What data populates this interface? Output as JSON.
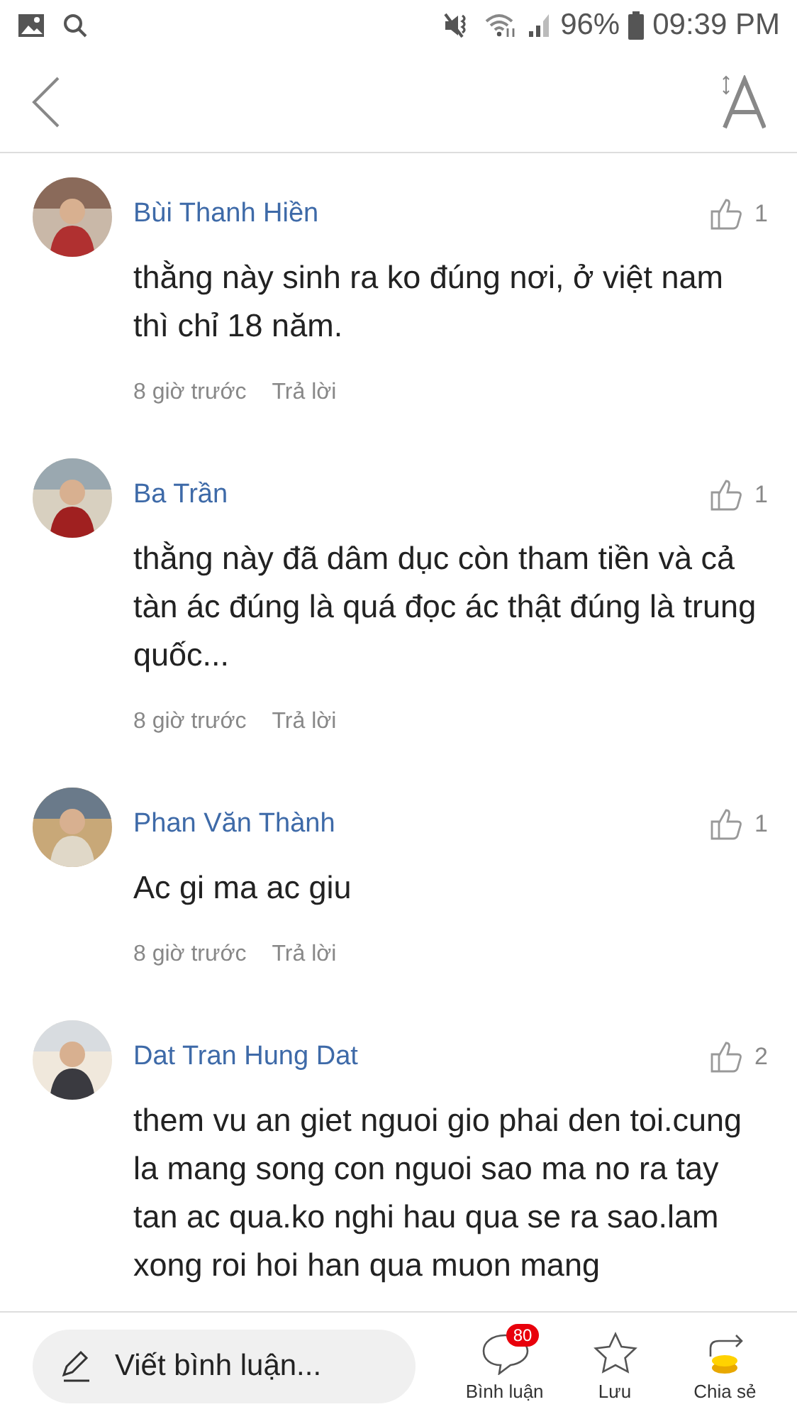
{
  "status_bar": {
    "battery": "96%",
    "time": "09:39 PM"
  },
  "comments": [
    {
      "author": "Bùi Thanh Hiền",
      "likes": "1",
      "text": "thằng này sinh ra ko đúng nơi, ở việt nam thì chỉ 18 năm.",
      "time": "8 giờ trước",
      "reply": "Trả lời"
    },
    {
      "author": "Ba Trần",
      "likes": "1",
      "text": "thằng này đã dâm dục còn tham tiền  và cả  tàn ác  đúng là quá đọc ác  thật đúng là trung quốc...",
      "time": "8 giờ trước",
      "reply": "Trả lời"
    },
    {
      "author": "Phan Văn Thành",
      "likes": "1",
      "text": "Ac gi ma ac giu",
      "time": "8 giờ trước",
      "reply": "Trả lời"
    },
    {
      "author": "Dat Tran Hung Dat",
      "likes": "2",
      "text": "them vu an giet nguoi gio phai den toi.cung la mang song con nguoi sao ma no ra tay tan ac qua.ko nghi hau qua se ra sao.lam xong roi hoi han qua muon mang"
    }
  ],
  "bottom_bar": {
    "placeholder": "Viết bình luận...",
    "comment_count": "80",
    "actions": [
      "Bình luận",
      "Lưu",
      "Chia sẻ"
    ]
  }
}
